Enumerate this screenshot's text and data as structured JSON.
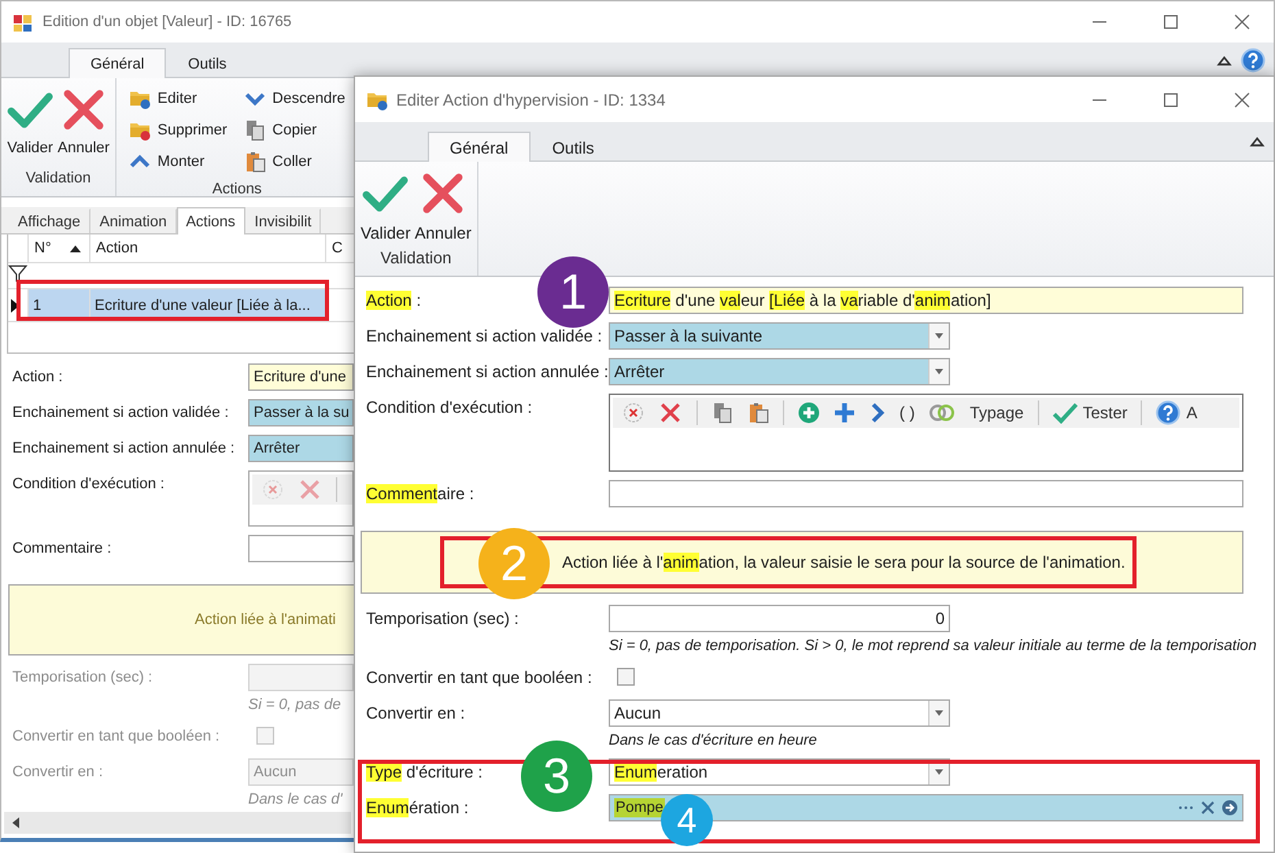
{
  "back_window": {
    "title": "Edition d'un objet [Valeur] - ID: 16765",
    "help_button": true,
    "ribbon_tabs": [
      {
        "label": "Général",
        "selected": true
      },
      {
        "label": "Outils",
        "selected": false
      }
    ],
    "ribbon_groups": [
      {
        "label": "Validation",
        "buttons": [
          {
            "kind": "validate",
            "label": "Valider"
          },
          {
            "kind": "cancel",
            "label": "Annuler"
          }
        ]
      },
      {
        "label": "Actions",
        "buttons": [
          {
            "kind": "edit",
            "label": "Editer"
          },
          {
            "kind": "delete",
            "label": "Supprimer"
          },
          {
            "kind": "up",
            "label": "Monter"
          },
          {
            "kind": "down",
            "label": "Descendre"
          },
          {
            "kind": "copy",
            "label": "Copier"
          },
          {
            "kind": "paste",
            "label": "Coller"
          }
        ]
      }
    ],
    "page_tabs": [
      {
        "label": "Affichage",
        "selected": false
      },
      {
        "label": "Animation",
        "selected": false
      },
      {
        "label": "Actions",
        "selected": true
      },
      {
        "label": "Invisibilit",
        "selected": false
      }
    ],
    "grid": {
      "columns": [
        "N°",
        "Action",
        "C"
      ],
      "rows": [
        {
          "cells": [
            "1",
            "Ecriture d'une valeur [Liée à la..."
          ],
          "selected": true
        }
      ]
    },
    "form": [
      {
        "kind": "text",
        "label": "Action :",
        "value": "Ecriture d'une",
        "readonly": true
      },
      {
        "kind": "combo",
        "label": "Enchainement si action validée :",
        "value": "Passer à la su",
        "required": true
      },
      {
        "kind": "combo",
        "label": "Enchainement si action annulée :",
        "value": "Arrêter",
        "required": true
      },
      {
        "kind": "condition",
        "label": "Condition d'exécution :",
        "disabled": true,
        "tools": [
          {
            "kind": "clear"
          },
          {
            "kind": "delete"
          },
          {
            "kind": "separator"
          }
        ]
      },
      {
        "kind": "text",
        "label": "Commentaire :",
        "readonly": false
      },
      {
        "kind": "info",
        "text": "Action liée à l'animati"
      },
      {
        "kind": "number",
        "label": "Temporisation (sec) :",
        "disabled": true,
        "hint": "Si = 0, pas de"
      },
      {
        "kind": "checkbox",
        "label": "Convertir en tant que booléen :",
        "checked": false,
        "disabled": true
      },
      {
        "kind": "combo",
        "label": "Convertir en :",
        "value": "Aucun",
        "disabled": true,
        "required": false,
        "hint": "Dans le cas d'"
      }
    ]
  },
  "front_window": {
    "title": "Editer Action d'hypervision - ID: 1334",
    "ribbon_tabs": [
      {
        "label": "Général",
        "selected": true
      },
      {
        "label": "Outils",
        "selected": false
      }
    ],
    "ribbon_groups": [
      {
        "label": "Validation",
        "buttons": [
          {
            "kind": "validate",
            "label": "Valider"
          },
          {
            "kind": "cancel",
            "label": "Annuler"
          }
        ]
      }
    ],
    "form": [
      {
        "kind": "text",
        "label": [
          {
            "text": "Action",
            "highlighted": true
          },
          {
            "text": " :",
            "highlighted": false
          }
        ],
        "value": [
          {
            "text": "Ecriture",
            "highlighted": true
          },
          {
            "text": " d'une ",
            "highlighted": false
          },
          {
            "text": "val",
            "highlighted": true
          },
          {
            "text": "eur ",
            "highlighted": false
          },
          {
            "text": "[Liée",
            "highlighted": true
          },
          {
            "text": " à la ",
            "highlighted": false
          },
          {
            "text": "va",
            "highlighted": true
          },
          {
            "text": "riable d'",
            "highlighted": false
          },
          {
            "text": "anim",
            "highlighted": true
          },
          {
            "text": "ation]",
            "highlighted": false
          }
        ],
        "readonly": true
      },
      {
        "kind": "combo",
        "label": "Enchainement si action validée :",
        "value": "Passer à la suivante",
        "required": true
      },
      {
        "kind": "combo",
        "label": "Enchainement si action annulée :",
        "value": "Arrêter",
        "required": true
      },
      {
        "kind": "condition",
        "label": "Condition d'exécution :",
        "disabled": false,
        "tools": [
          {
            "kind": "clear"
          },
          {
            "kind": "delete"
          },
          {
            "kind": "separator"
          },
          {
            "kind": "copy"
          },
          {
            "kind": "paste"
          },
          {
            "kind": "separator"
          },
          {
            "kind": "add"
          },
          {
            "kind": "plus"
          },
          {
            "kind": "next"
          },
          {
            "kind": "text",
            "label": "( )"
          },
          {
            "kind": "link"
          },
          {
            "kind": "text",
            "label": "Typage"
          },
          {
            "kind": "separator"
          },
          {
            "kind": "test",
            "label": "Tester"
          },
          {
            "kind": "separator"
          },
          {
            "kind": "help",
            "label": "A"
          }
        ]
      },
      {
        "kind": "text",
        "label": [
          {
            "text": "Comment",
            "highlighted": true
          },
          {
            "text": "aire :",
            "highlighted": false
          }
        ],
        "readonly": false
      },
      {
        "kind": "info",
        "text": [
          {
            "text": "Action liée à l'",
            "highlighted": false
          },
          {
            "text": "anim",
            "highlighted": true
          },
          {
            "text": "ation, la valeur saisie le sera pour la source de l'animation.",
            "highlighted": false
          }
        ]
      },
      {
        "kind": "number",
        "label": "Temporisation (sec) :",
        "value": "0",
        "disabled": false,
        "hint": "Si = 0, pas de temporisation. Si > 0, le mot reprend sa valeur initiale au terme de la temporisation"
      },
      {
        "kind": "checkbox",
        "label": "Convertir en tant que booléen :",
        "checked": false,
        "disabled": false
      },
      {
        "kind": "combo",
        "label": "Convertir en :",
        "value": "Aucun",
        "required": false,
        "disabled": false,
        "hint": "Dans le cas d'écriture en heure"
      },
      {
        "kind": "combo",
        "label": [
          {
            "text": "Type",
            "highlighted": true
          },
          {
            "text": " d'écriture :",
            "highlighted": false
          }
        ],
        "value": [
          {
            "text": "Enum",
            "highlighted": true
          },
          {
            "text": "eration",
            "highlighted": false
          }
        ],
        "required": false
      },
      {
        "kind": "lookup",
        "label": [
          {
            "text": "Enum",
            "highlighted": true
          },
          {
            "text": "ération :",
            "highlighted": false
          }
        ],
        "tags": [
          {
            "text": "Pompe",
            "highlighted": true
          }
        ],
        "required": true
      }
    ]
  },
  "callouts": [
    {
      "label": "1",
      "color": "#6a2c91"
    },
    {
      "label": "2",
      "color": "#f5b21b"
    },
    {
      "label": "3",
      "color": "#1fa24a"
    },
    {
      "label": "4",
      "color": "#1da6e0"
    }
  ]
}
